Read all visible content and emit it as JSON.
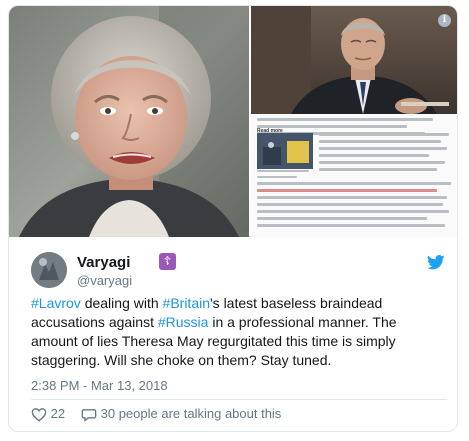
{
  "tweet": {
    "author": {
      "display_name": "Varyagi",
      "handle": "@varyagi",
      "badge_glyph": "☦"
    },
    "text_parts": [
      {
        "text": "#Lavrov",
        "hashtag": true
      },
      {
        "text": " dealing with ",
        "hashtag": false
      },
      {
        "text": "#Britain",
        "hashtag": true
      },
      {
        "text": "'s latest baseless braindead accusations against ",
        "hashtag": false
      },
      {
        "text": "#Russia",
        "hashtag": true
      },
      {
        "text": " in a professional manner.  The amount of lies Theresa May regurgitated this time is simply staggering.  Will she choke on them?  Stay tuned.",
        "hashtag": false
      }
    ],
    "timestamp": "2:38 PM - Mar 13, 2018",
    "likes": "22",
    "talking": "30 people are talking about this"
  },
  "media": {
    "read_more_label": "Read more"
  },
  "icons": {
    "brand": "twitter-bird-icon",
    "info": "info-icon",
    "like": "heart-icon",
    "reply": "speech-bubble-icon"
  },
  "colors": {
    "hashtag": "#1b95e0",
    "twitter_blue": "#1da1f2",
    "muted": "#657786",
    "badge": "#9b59b6"
  }
}
